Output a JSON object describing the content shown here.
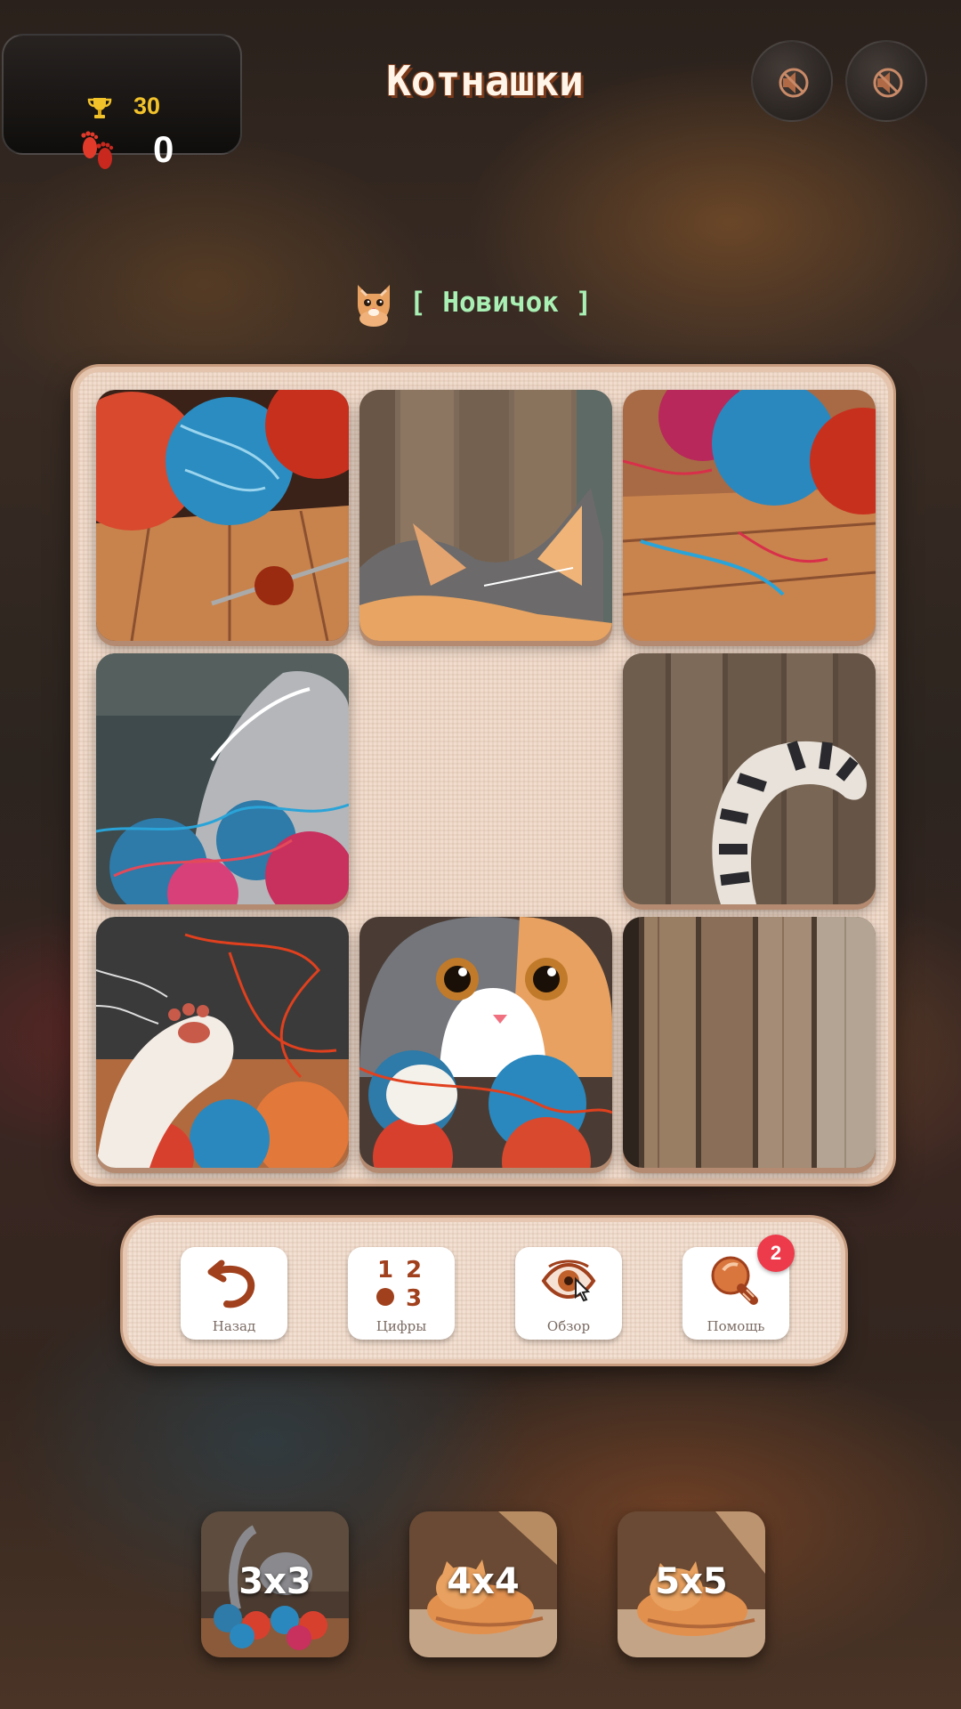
{
  "game": {
    "title": "Котнашки",
    "level_label": "[ Новичок ]"
  },
  "stats": {
    "best": "30",
    "moves": "0"
  },
  "header_buttons": [
    {
      "name": "sound",
      "icon": "muted-speaker-icon"
    },
    {
      "name": "music",
      "icon": "muted-speaker-icon"
    }
  ],
  "board": {
    "grid": "3x3",
    "empty_cell": 5,
    "tiles": [
      {
        "cell": 1,
        "piece": "yarn-balls-with-needle"
      },
      {
        "cell": 2,
        "piece": "kitten-ears"
      },
      {
        "cell": 3,
        "piece": "yarn-balls-on-floor"
      },
      {
        "cell": 4,
        "piece": "kitten-back-in-yarn"
      },
      {
        "cell": 6,
        "piece": "striped-tail"
      },
      {
        "cell": 7,
        "piece": "raised-paw"
      },
      {
        "cell": 8,
        "piece": "kitten-face"
      },
      {
        "cell": 9,
        "piece": "wooden-planks"
      }
    ]
  },
  "toolbar": {
    "undo_label": "Назад",
    "numbers_label": "Цифры",
    "numbers_icon_text": [
      "1",
      "2",
      "3"
    ],
    "preview_label": "Обзор",
    "hint_label": "Помощь",
    "hint_badge": "2"
  },
  "sizes": [
    {
      "label": "3x3"
    },
    {
      "label": "4x4"
    },
    {
      "label": "5x5"
    }
  ],
  "colors": {
    "accent_brown": "#a0401c",
    "badge_red": "#ee3b4b",
    "level_green": "#a9f0b4",
    "trophy_gold": "#f2c22b"
  }
}
